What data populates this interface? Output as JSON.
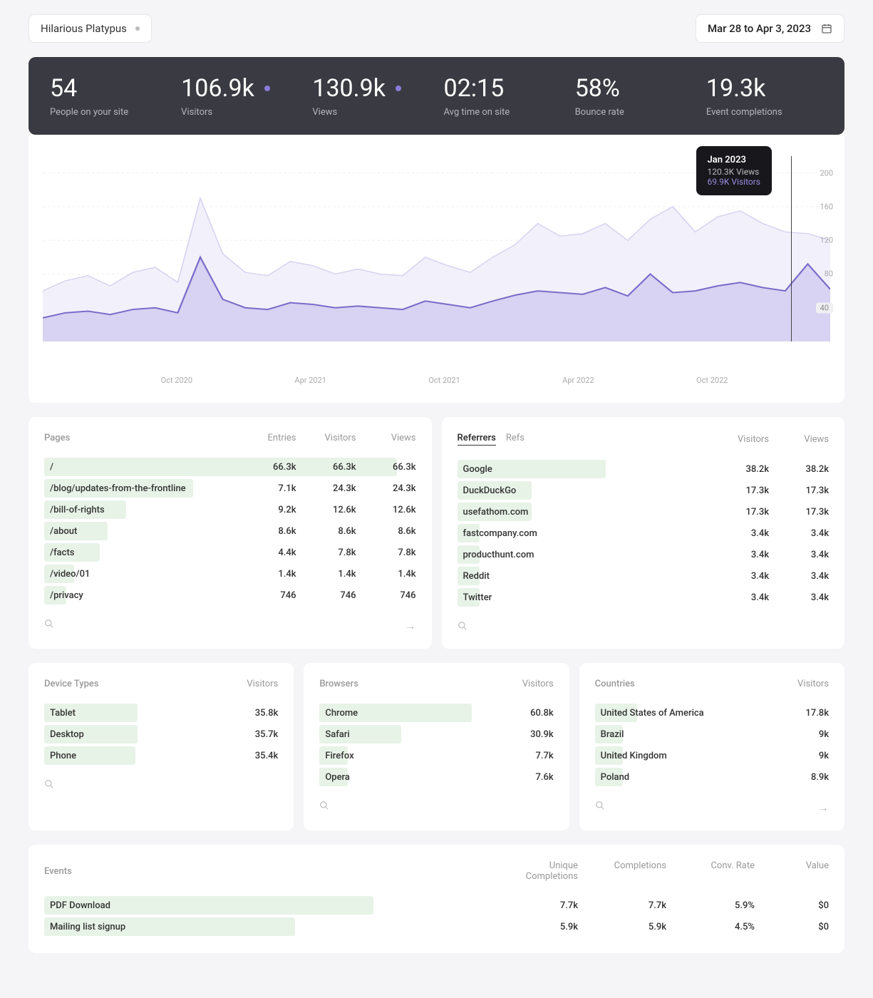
{
  "header": {
    "site_name": "Hilarious Platypus",
    "date_range": "Mar 28 to Apr 3, 2023"
  },
  "summary": [
    {
      "value": "54",
      "label": "People on your site",
      "dot": false
    },
    {
      "value": "106.9k",
      "label": "Visitors",
      "dot": true
    },
    {
      "value": "130.9k",
      "label": "Views",
      "dot": true
    },
    {
      "value": "02:15",
      "label": "Avg time on site",
      "dot": false
    },
    {
      "value": "58%",
      "label": "Bounce rate",
      "dot": false
    },
    {
      "value": "19.3k",
      "label": "Event completions",
      "dot": false
    }
  ],
  "chart_data": {
    "type": "area",
    "x_labels": [
      "Oct 2020",
      "Apr 2021",
      "Oct 2021",
      "Apr 2022",
      "Oct 2022"
    ],
    "ylim": [
      0,
      220
    ],
    "y_ticks": [
      200,
      160,
      120,
      80
    ],
    "y_highlight": 40,
    "series": [
      {
        "name": "Views",
        "color": "#eceaf8",
        "values": [
          60,
          72,
          78,
          66,
          82,
          88,
          70,
          170,
          104,
          82,
          78,
          95,
          90,
          80,
          86,
          80,
          78,
          100,
          90,
          82,
          100,
          115,
          140,
          125,
          128,
          140,
          120,
          145,
          160,
          130,
          148,
          155,
          140,
          130,
          128,
          120
        ]
      },
      {
        "name": "Visitors",
        "color": "#8b7bd8",
        "values": [
          28,
          34,
          36,
          32,
          38,
          40,
          34,
          100,
          50,
          40,
          38,
          46,
          44,
          40,
          42,
          40,
          38,
          48,
          44,
          40,
          48,
          55,
          60,
          58,
          56,
          64,
          54,
          80,
          58,
          60,
          66,
          70,
          64,
          60,
          92,
          62
        ]
      }
    ],
    "tooltip": {
      "title": "Jan 2023",
      "views": "120.3K Views",
      "visitors": "69.9K Visitors"
    }
  },
  "pages": {
    "title": "Pages",
    "cols": [
      "Entries",
      "Visitors",
      "Views"
    ],
    "rows": [
      {
        "label": "/",
        "vals": [
          "66.3k",
          "66.3k",
          "66.3k"
        ],
        "bar": 95
      },
      {
        "label": "/blog/updates-from-the-frontline",
        "vals": [
          "7.1k",
          "24.3k",
          "24.3k"
        ],
        "bar": 40
      },
      {
        "label": "/bill-of-rights",
        "vals": [
          "9.2k",
          "12.6k",
          "12.6k"
        ],
        "bar": 22
      },
      {
        "label": "/about",
        "vals": [
          "8.6k",
          "8.6k",
          "8.6k"
        ],
        "bar": 17
      },
      {
        "label": "/facts",
        "vals": [
          "4.4k",
          "7.8k",
          "7.8k"
        ],
        "bar": 15
      },
      {
        "label": "/video/01",
        "vals": [
          "1.4k",
          "1.4k",
          "1.4k"
        ],
        "bar": 8
      },
      {
        "label": "/privacy",
        "vals": [
          "746",
          "746",
          "746"
        ],
        "bar": 6
      }
    ]
  },
  "referrers": {
    "tabs": [
      "Referrers",
      "Refs"
    ],
    "cols": [
      "Visitors",
      "Views"
    ],
    "rows": [
      {
        "label": "Google",
        "vals": [
          "38.2k",
          "38.2k"
        ],
        "bar": 40
      },
      {
        "label": "DuckDuckGo",
        "vals": [
          "17.3k",
          "17.3k"
        ],
        "bar": 20
      },
      {
        "label": "usefathom.com",
        "vals": [
          "17.3k",
          "17.3k"
        ],
        "bar": 20
      },
      {
        "label": "fastcompany.com",
        "vals": [
          "3.4k",
          "3.4k"
        ],
        "bar": 6
      },
      {
        "label": "producthunt.com",
        "vals": [
          "3.4k",
          "3.4k"
        ],
        "bar": 6
      },
      {
        "label": "Reddit",
        "vals": [
          "3.4k",
          "3.4k"
        ],
        "bar": 6
      },
      {
        "label": "Twitter",
        "vals": [
          "3.4k",
          "3.4k"
        ],
        "bar": 6
      }
    ]
  },
  "devices": {
    "title": "Device Types",
    "col": "Visitors",
    "rows": [
      {
        "label": "Tablet",
        "vals": [
          "35.8k"
        ],
        "bar": 40
      },
      {
        "label": "Desktop",
        "vals": [
          "35.7k"
        ],
        "bar": 40
      },
      {
        "label": "Phone",
        "vals": [
          "35.4k"
        ],
        "bar": 39
      }
    ]
  },
  "browsers": {
    "title": "Browsers",
    "col": "Visitors",
    "rows": [
      {
        "label": "Chrome",
        "vals": [
          "60.8k"
        ],
        "bar": 65
      },
      {
        "label": "Safari",
        "vals": [
          "30.9k"
        ],
        "bar": 35
      },
      {
        "label": "Firefox",
        "vals": [
          "7.7k"
        ],
        "bar": 12
      },
      {
        "label": "Opera",
        "vals": [
          "7.6k"
        ],
        "bar": 12
      }
    ]
  },
  "countries": {
    "title": "Countries",
    "col": "Visitors",
    "rows": [
      {
        "label": "United States of America",
        "vals": [
          "17.8k"
        ],
        "bar": 18
      },
      {
        "label": "Brazil",
        "vals": [
          "9k"
        ],
        "bar": 12
      },
      {
        "label": "United Kingdom",
        "vals": [
          "9k"
        ],
        "bar": 12
      },
      {
        "label": "Poland",
        "vals": [
          "8.9k"
        ],
        "bar": 12
      }
    ]
  },
  "events": {
    "title": "Events",
    "cols": [
      "Unique Completions",
      "Completions",
      "Conv. Rate",
      "Value"
    ],
    "rows": [
      {
        "label": "PDF Download",
        "vals": [
          "7.7k",
          "7.7k",
          "5.9%",
          "$0"
        ],
        "bar": 42
      },
      {
        "label": "Mailing list signup",
        "vals": [
          "5.9k",
          "5.9k",
          "4.5%",
          "$0"
        ],
        "bar": 32
      }
    ]
  }
}
